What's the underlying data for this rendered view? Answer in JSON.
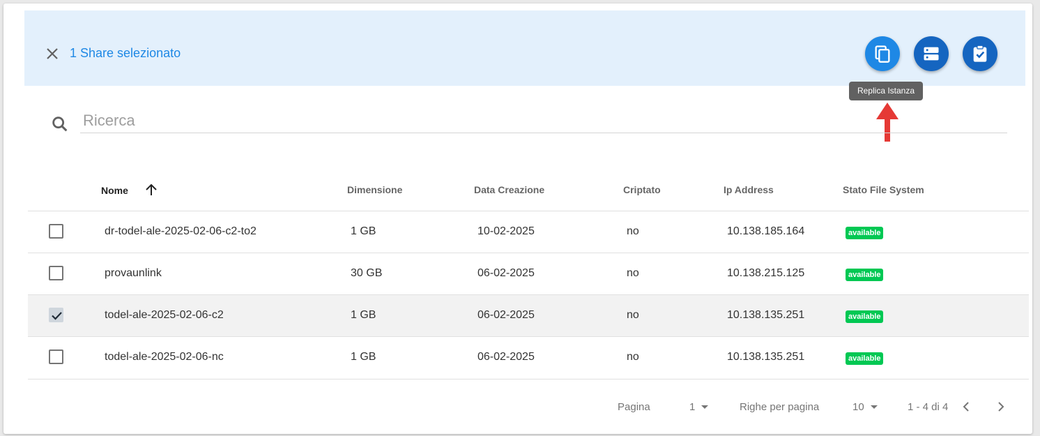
{
  "selection_bar": {
    "text": "1 Share selezionato"
  },
  "actions": {
    "tooltip": "Replica Istanza"
  },
  "search": {
    "placeholder": "Ricerca"
  },
  "table": {
    "headers": {
      "nome": "Nome",
      "dimensione": "Dimensione",
      "data_creazione": "Data Creazione",
      "criptato": "Criptato",
      "ip_address": "Ip Address",
      "stato_fs": "Stato File System"
    },
    "rows": [
      {
        "nome": "dr-todel-ale-2025-02-06-c2-to2",
        "dimensione": "1 GB",
        "data": "10-02-2025",
        "criptato": "no",
        "ip": "10.138.185.164",
        "stato": "available",
        "checked": false
      },
      {
        "nome": "provaunlink",
        "dimensione": "30 GB",
        "data": "06-02-2025",
        "criptato": "no",
        "ip": "10.138.215.125",
        "stato": "available",
        "checked": false
      },
      {
        "nome": "todel-ale-2025-02-06-c2",
        "dimensione": "1 GB",
        "data": "06-02-2025",
        "criptato": "no",
        "ip": "10.138.135.251",
        "stato": "available",
        "checked": true
      },
      {
        "nome": "todel-ale-2025-02-06-nc",
        "dimensione": "1 GB",
        "data": "06-02-2025",
        "criptato": "no",
        "ip": "10.138.135.251",
        "stato": "available",
        "checked": false
      }
    ]
  },
  "pagination": {
    "page_label": "Pagina",
    "page_value": "1",
    "rows_label": "Righe per pagina",
    "rows_value": "10",
    "range": "1 - 4 di 4"
  },
  "colors": {
    "accent": "#1e88e5",
    "selection_bg": "#e3f0fc",
    "badge_green": "#00c853",
    "arrow_red": "#e53935"
  },
  "icons": {
    "close": "close-icon",
    "copy": "copy-icon",
    "server": "server-icon",
    "clipboard": "clipboard-check-icon",
    "search": "search-icon",
    "sort": "arrow-up-icon",
    "prev": "chevron-left-icon",
    "next": "chevron-right-icon"
  }
}
